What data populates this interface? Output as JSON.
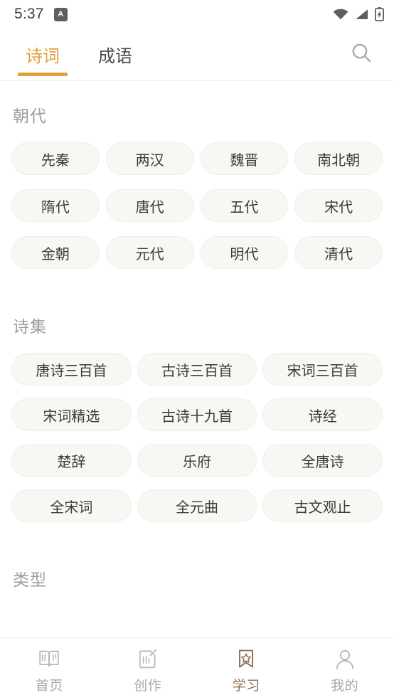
{
  "status_bar": {
    "time": "5:37",
    "notification_badge": "A",
    "icons": [
      "wifi-icon",
      "cellular-signal-icon",
      "battery-charging-icon"
    ]
  },
  "colors": {
    "accent_orange": "#e3a03c",
    "accent_brown": "#8d6e50",
    "pill_bg": "#f8f7f3",
    "section_title": "#9d9d9d",
    "inactive_nav": "#a8a8a8"
  },
  "header": {
    "tabs": [
      {
        "label": "诗词",
        "active": true
      },
      {
        "label": "成语",
        "active": false
      }
    ],
    "search_icon": "search-icon"
  },
  "sections": [
    {
      "title": "朝代",
      "columns": 4,
      "items": [
        "先秦",
        "两汉",
        "魏晋",
        "南北朝",
        "隋代",
        "唐代",
        "五代",
        "宋代",
        "金朝",
        "元代",
        "明代",
        "清代"
      ]
    },
    {
      "title": "诗集",
      "columns": 3,
      "items": [
        "唐诗三百首",
        "古诗三百首",
        "宋词三百首",
        "宋词精选",
        "古诗十九首",
        "诗经",
        "楚辞",
        "乐府",
        "全唐诗",
        "全宋词",
        "全元曲",
        "古文观止"
      ]
    },
    {
      "title": "类型",
      "columns": 4,
      "items": []
    }
  ],
  "bottom_nav": {
    "items": [
      {
        "label": "首页",
        "icon": "open-book-icon",
        "active": false
      },
      {
        "label": "创作",
        "icon": "document-pen-icon",
        "active": false
      },
      {
        "label": "学习",
        "icon": "bookmark-star-icon",
        "active": true
      },
      {
        "label": "我的",
        "icon": "person-icon",
        "active": false
      }
    ]
  }
}
